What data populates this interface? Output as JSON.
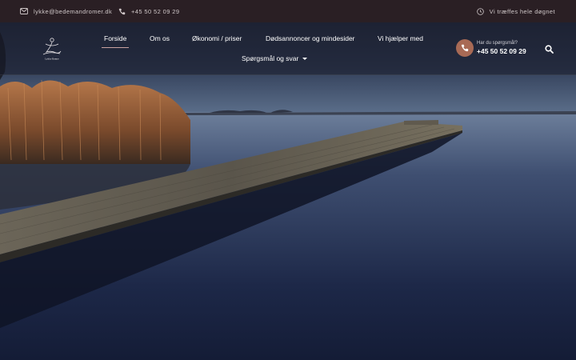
{
  "topbar": {
    "email": "lykke@bedemandromer.dk",
    "phone": "+45 50 52 09 29",
    "hours": "Vi træffes hele døgnet"
  },
  "logo": {
    "text": "Lykke Rømer"
  },
  "nav": {
    "items": [
      {
        "label": "Forside"
      },
      {
        "label": "Om os"
      },
      {
        "label": "Økonomi / priser"
      },
      {
        "label": "Dødsannoncer og mindesider"
      },
      {
        "label": "Vi hjælper med"
      },
      {
        "label": "Spørgsmål og svar"
      }
    ],
    "active": "Forside"
  },
  "call": {
    "label": "Har du spørgsmål?",
    "number": "+45 50 52 09 29"
  },
  "colors": {
    "topbar_bg": "#2a1f24",
    "accent": "#a86a55",
    "active_underline": "#c9a3a0"
  },
  "icons": {
    "email": "envelope-icon",
    "phone": "phone-icon",
    "hours": "clock-icon",
    "call": "phone-circle-icon",
    "search": "search-icon",
    "dropdown": "caret-down-icon"
  }
}
